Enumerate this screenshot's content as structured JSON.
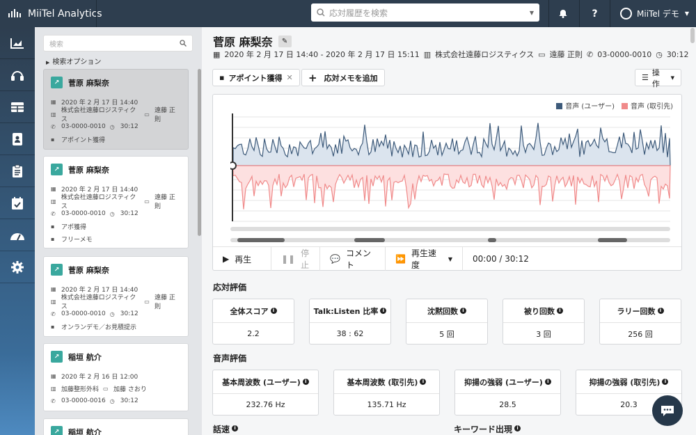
{
  "app": {
    "title": "MiiTel Analytics"
  },
  "header": {
    "search_placeholder": "応対履歴を検索",
    "user_name": "MiiTel デモ"
  },
  "sidebar": {
    "icons": [
      "chart-icon",
      "headset-icon",
      "table-icon",
      "contacts-icon",
      "clipboard-icon",
      "calendar-icon",
      "dashboard-icon",
      "settings-icon"
    ]
  },
  "list": {
    "search_placeholder": "検索",
    "search_options": "検索オプション",
    "items": [
      {
        "name": "菅原 麻梨奈",
        "datetime": "2020 年 2 月 17 日 14:40",
        "company": "株式会社遠藤ロジスティクス",
        "rep": "遠藤 正則",
        "phone": "03-0000-0010",
        "duration": "30:12",
        "tags": [
          "アポイント獲得"
        ],
        "selected": true
      },
      {
        "name": "菅原 麻梨奈",
        "datetime": "2020 年 2 月 17 日 14:40",
        "company": "株式会社遠藤ロジスティクス",
        "rep": "遠藤 正則",
        "phone": "03-0000-0010",
        "duration": "30:12",
        "tags": [
          "アポ獲得",
          "フリーメモ"
        ]
      },
      {
        "name": "菅原 麻梨奈",
        "datetime": "2020 年 2 月 17 日 14:40",
        "company": "株式会社遠藤ロジスティクス",
        "rep": "遠藤 正則",
        "phone": "03-0000-0010",
        "duration": "30:12",
        "tags": [
          "オンランデモ／お見積提示"
        ]
      },
      {
        "name": "稲垣 航介",
        "datetime": "2020 年 2 月 16 日 12:00",
        "company": "加藤整形外科",
        "rep": "加藤 さおり",
        "phone": "03-0000-0016",
        "duration": "30:12",
        "tags": []
      },
      {
        "name": "稲垣 航介",
        "datetime": "",
        "company": "",
        "rep": "",
        "phone": "",
        "duration": "",
        "tags": []
      }
    ]
  },
  "detail": {
    "name": "菅原 麻梨奈",
    "period": "2020 年 2 月 17 日 14:40 - 2020 年 2 月 17 日 15:11",
    "company": "株式会社遠藤ロジスティクス",
    "rep": "遠藤 正則",
    "phone": "03-0000-0010",
    "duration": "30:12",
    "tag_label": "アポイント獲得",
    "add_memo": "応対メモを追加",
    "ops": "操作"
  },
  "player": {
    "legend_user": "音声 (ユーザー)",
    "legend_client": "音声 (取引先)",
    "color_user": "#3d5a7a",
    "color_client": "#f08a8a",
    "play": "再生",
    "stop": "停止",
    "comment": "コメント",
    "speed": "再生速度",
    "time": "00:00 / 30:12"
  },
  "evaluation": {
    "title": "応対評価",
    "metrics": [
      {
        "label": "全体スコア",
        "value": "2.2"
      },
      {
        "label": "Talk:Listen 比率",
        "value": "38 : 62"
      },
      {
        "label": "沈黙回数",
        "value": "5 回"
      },
      {
        "label": "被り回数",
        "value": "3 回"
      },
      {
        "label": "ラリー回数",
        "value": "256 回"
      }
    ]
  },
  "voice": {
    "title": "音声評価",
    "metrics": [
      {
        "label": "基本周波数 (ユーザー)",
        "value": "232.76 Hz"
      },
      {
        "label": "基本周波数 (取引先)",
        "value": "135.71 Hz"
      },
      {
        "label": "抑揚の強弱 (ユーザー)",
        "value": "28.5"
      },
      {
        "label": "抑揚の強弱 (取引先)",
        "value": "20.3"
      }
    ]
  },
  "bottom": {
    "speed_title": "話速",
    "keyword_title": "キーワード出現"
  }
}
